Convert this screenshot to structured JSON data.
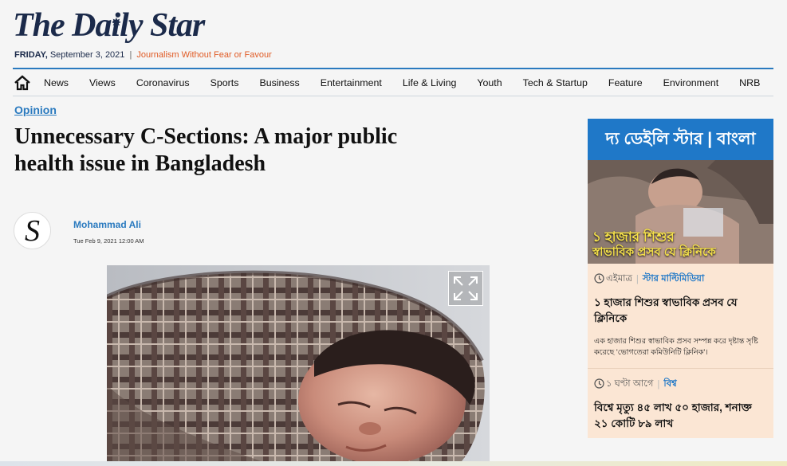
{
  "masthead": {
    "title": "The Daily Star",
    "date_day": "FRIDAY,",
    "date_rest": "September 3, 2021",
    "separator": "|",
    "tagline": "Journalism Without Fear or Favour"
  },
  "nav": {
    "items": [
      "News",
      "Views",
      "Coronavirus",
      "Sports",
      "Business",
      "Entertainment",
      "Life & Living",
      "Youth",
      "Tech & Startup",
      "Feature",
      "Environment",
      "NRB"
    ]
  },
  "article": {
    "category": "Opinion",
    "headline": "Unnecessary C-Sections: A major public health issue in Bangladesh",
    "author": "Mohammad Ali",
    "published": "Tue Feb 9, 2021 12:00 AM",
    "avatar_letter": "S"
  },
  "sidebar": {
    "header": "দ্য ডেইলি স্টার | বাংলা",
    "promo_line1": "১ হাজার শিশুর",
    "promo_line2": "স্বাভাবিক প্রসব যে ক্লিনিকে",
    "stories": [
      {
        "time": "এইমাত্র",
        "category": "স্টার মাল্টিমিডিয়া",
        "title": "১ হাজার শিশুর স্বাভাবিক প্রসব যে ক্লিনিকে",
        "desc": "এক হাজার শিশুর স্বাভাবিক প্রসব সম্পন্ন করে দৃষ্টান্ত সৃষ্টি করেছে 'ভোগতেরা কমিউনিটি ক্লিনিক'।"
      },
      {
        "time": "১ ঘণ্টা আগে",
        "category": "বিশ্ব",
        "title": "বিশ্বে মৃত্যু ৪৫ লাখ ৫০ হাজার, শনাক্ত ২১ কোটি ৮৯ লাখ"
      }
    ]
  },
  "colors": {
    "accent": "#2a7abf",
    "tagline": "#e05a24",
    "bangla_header": "#1f78c8",
    "sidebar_bg": "#fbe6d4",
    "promo_text": "#f5e14a"
  },
  "icons": [
    "home-icon",
    "expand-icon",
    "clock-icon"
  ]
}
